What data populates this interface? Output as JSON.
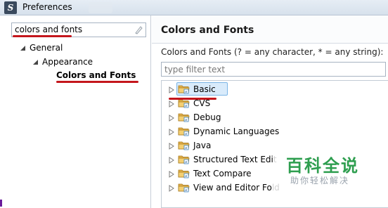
{
  "window": {
    "title": "Preferences"
  },
  "filter": {
    "value": "colors and fonts"
  },
  "tree": {
    "general": "General",
    "appearance": "Appearance",
    "colors_and_fonts": "Colors and Fonts"
  },
  "page": {
    "title": "Colors and Fonts",
    "instructions": "Colors and Fonts (? = any character, * = any string):",
    "type_filter_placeholder": "type filter text"
  },
  "categories": [
    "Basic",
    "CVS",
    "Debug",
    "Dynamic Languages",
    "Java",
    "Structured Text Edit",
    "Text Compare",
    "View and Editor Fold"
  ],
  "watermark": {
    "main": "百科全说",
    "sub": "助你轻松解决"
  },
  "colors": {
    "annotation_underline": "#c4161c",
    "selection": "#d9ebfb",
    "folder": "#e3b04b"
  }
}
